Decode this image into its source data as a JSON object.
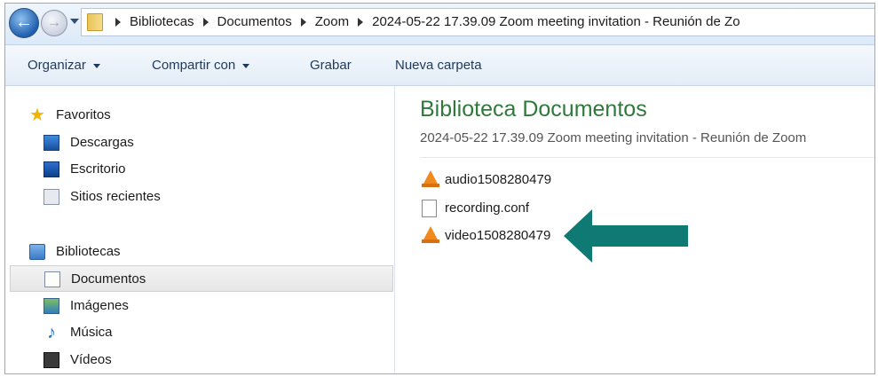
{
  "address_bar": {
    "breadcrumbs": [
      "Bibliotecas",
      "Documentos",
      "Zoom",
      "2024-05-22 17.39.09 Zoom meeting invitation - Reunión de Zo"
    ]
  },
  "toolbar": {
    "organize_label": "Organizar",
    "share_label": "Compartir con",
    "burn_label": "Grabar",
    "new_folder_label": "Nueva carpeta"
  },
  "nav_pane": {
    "favorites": {
      "label": "Favoritos",
      "items": [
        {
          "label": "Descargas",
          "icon": "downloads-icon"
        },
        {
          "label": "Escritorio",
          "icon": "desktop-icon"
        },
        {
          "label": "Sitios recientes",
          "icon": "recent-places-icon"
        }
      ]
    },
    "libraries": {
      "label": "Bibliotecas",
      "items": [
        {
          "label": "Documentos",
          "icon": "documents-icon",
          "selected": true
        },
        {
          "label": "Imágenes",
          "icon": "pictures-icon"
        },
        {
          "label": "Música",
          "icon": "music-icon"
        },
        {
          "label": "Vídeos",
          "icon": "videos-icon"
        }
      ]
    }
  },
  "content": {
    "library_title": "Biblioteca Documentos",
    "folder_subtitle": "2024-05-22 17.39.09 Zoom meeting invitation - Reunión de Zoom",
    "files": [
      {
        "name": "audio1508280479",
        "icon": "vlc-icon"
      },
      {
        "name": "recording.conf",
        "icon": "document-icon"
      },
      {
        "name": "video1508280479",
        "icon": "vlc-icon"
      }
    ]
  },
  "colors": {
    "library_title": "#2f7a3a",
    "annotation_arrow": "#0e7a73",
    "vlc_cone": "#f08a1c"
  }
}
